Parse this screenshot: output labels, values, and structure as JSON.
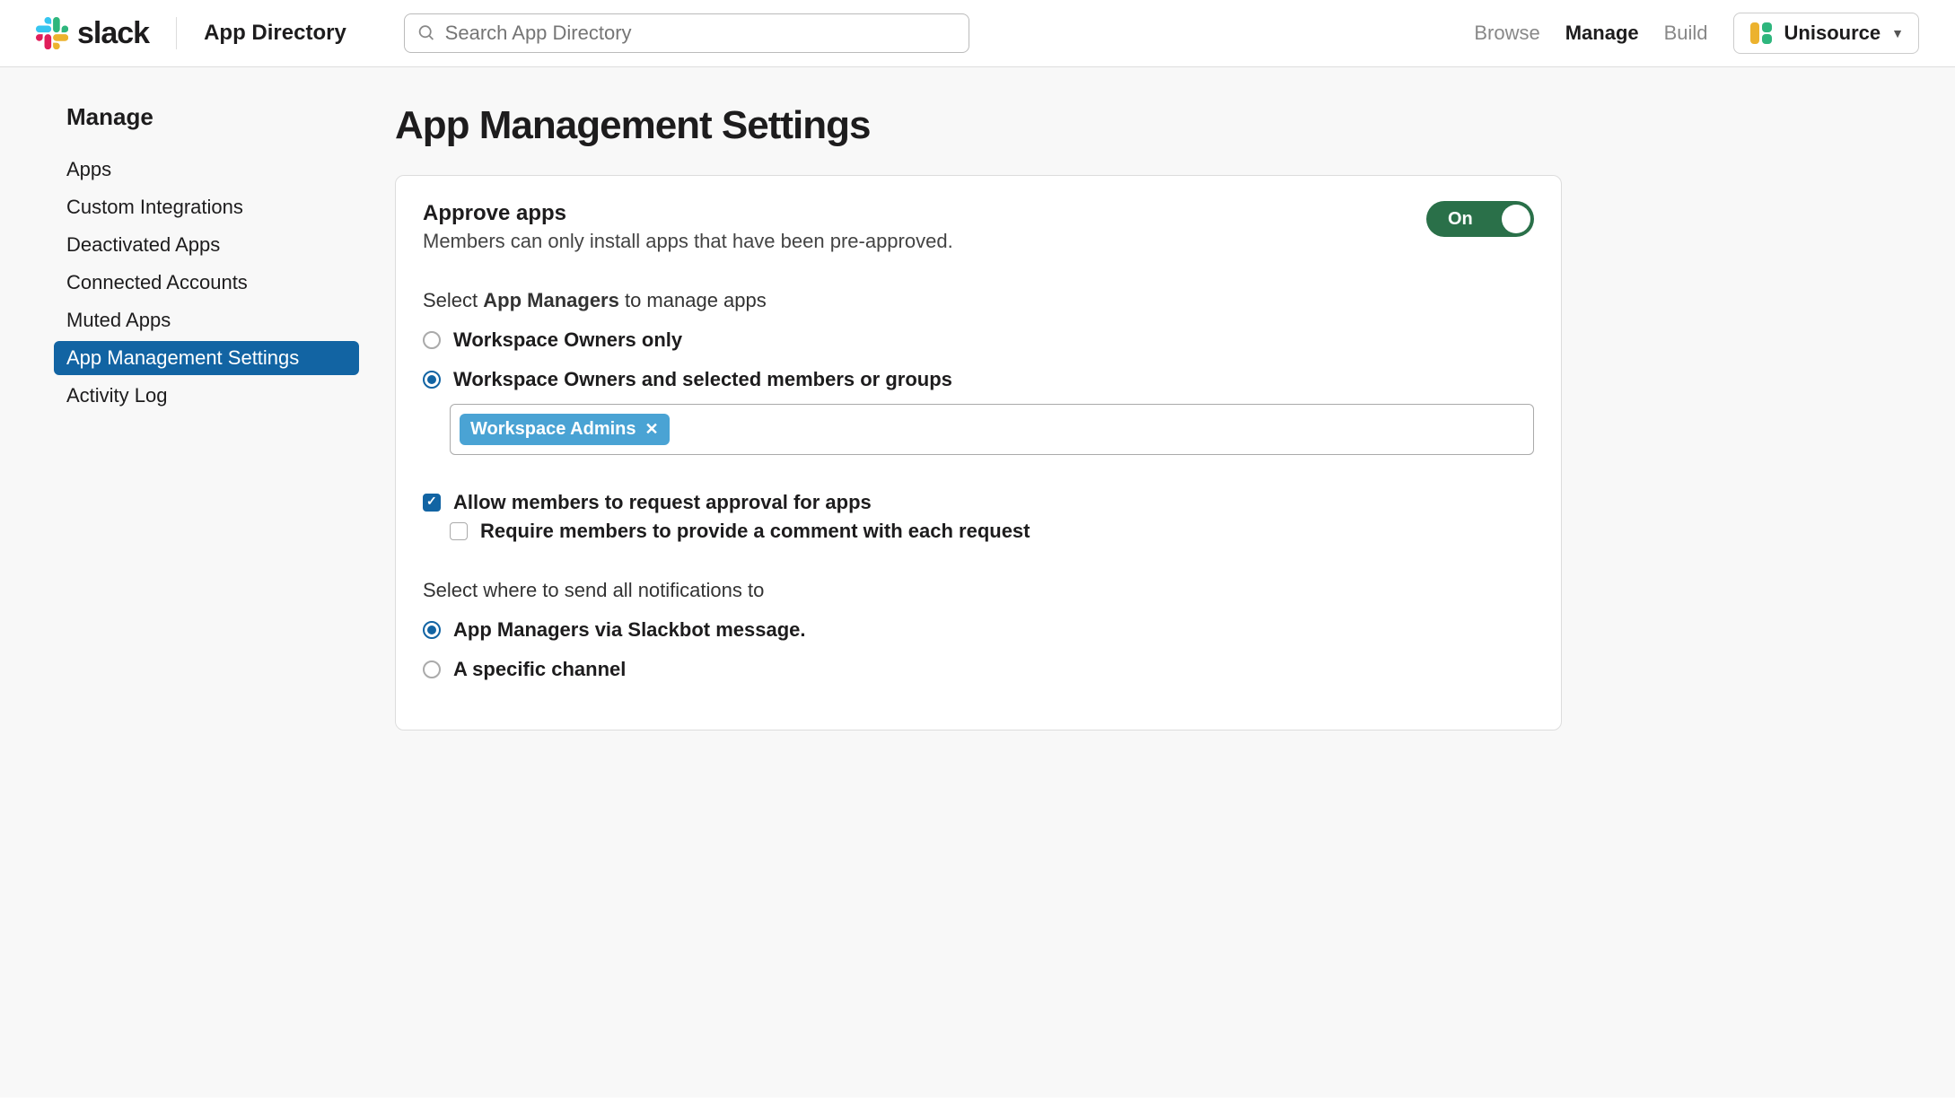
{
  "header": {
    "brand": "slack",
    "app_directory": "App Directory",
    "search_placeholder": "Search App Directory",
    "nav": {
      "browse": "Browse",
      "manage": "Manage",
      "build": "Build"
    },
    "workspace": "Unisource"
  },
  "sidebar": {
    "title": "Manage",
    "items": [
      "Apps",
      "Custom Integrations",
      "Deactivated Apps",
      "Connected Accounts",
      "Muted Apps",
      "App Management Settings",
      "Activity Log"
    ],
    "selected_index": 5
  },
  "page": {
    "title": "App Management Settings",
    "approve": {
      "heading": "Approve apps",
      "subtext": "Members can only install apps that have been pre-approved.",
      "toggle_label": "On",
      "toggle_on": true
    },
    "managers": {
      "prefix": "Select ",
      "strong": "App Managers",
      "suffix": " to manage apps",
      "options": [
        "Workspace Owners only",
        "Workspace Owners and selected members or groups"
      ],
      "selected_index": 1,
      "tag": "Workspace Admins"
    },
    "requests": {
      "allow_label": "Allow members to request approval for apps",
      "allow_checked": true,
      "require_label": "Require members to provide a comment with each request",
      "require_checked": false
    },
    "notify": {
      "label": "Select where to send all notifications to",
      "options": [
        "App Managers via Slackbot message.",
        "A specific channel"
      ],
      "selected_index": 0
    }
  }
}
